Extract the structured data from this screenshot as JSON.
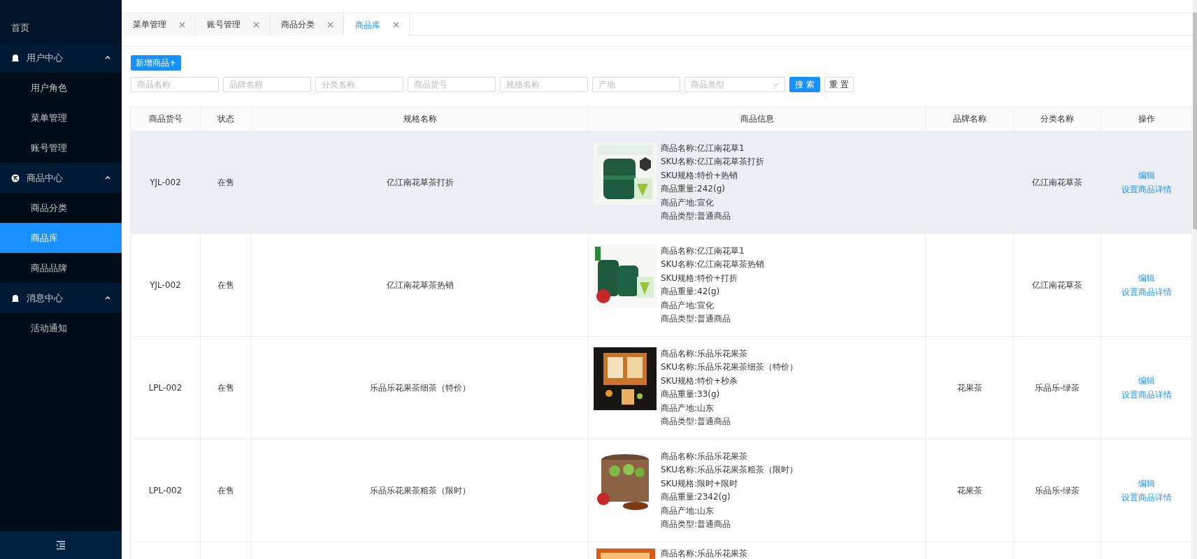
{
  "sidebar": {
    "items": [
      {
        "kind": "link",
        "label": "首页",
        "selected": false
      },
      {
        "kind": "group",
        "label": "用户中心",
        "expanded": true,
        "children": [
          {
            "label": "用户角色",
            "selected": false
          },
          {
            "label": "菜单管理",
            "selected": false
          },
          {
            "label": "账号管理",
            "selected": false
          }
        ]
      },
      {
        "kind": "group",
        "label": "商品中心",
        "expanded": true,
        "children": [
          {
            "label": "商品分类",
            "selected": false
          },
          {
            "label": "商品库",
            "selected": true
          },
          {
            "label": "商品品牌",
            "selected": false
          }
        ]
      },
      {
        "kind": "group",
        "label": "消息中心",
        "expanded": true,
        "children": [
          {
            "label": "活动通知",
            "selected": false
          }
        ]
      }
    ]
  },
  "tabs": [
    {
      "label": "菜单管理",
      "selected": false
    },
    {
      "label": "账号管理",
      "selected": false
    },
    {
      "label": "商品分类",
      "selected": false
    },
    {
      "label": "商品库",
      "selected": true
    }
  ],
  "add_button": "新增商品+",
  "filters": [
    {
      "kind": "input",
      "placeholder": "商品名称"
    },
    {
      "kind": "input",
      "placeholder": "品牌名称"
    },
    {
      "kind": "input",
      "placeholder": "分类名称"
    },
    {
      "kind": "input",
      "placeholder": "商品货号"
    },
    {
      "kind": "input",
      "placeholder": "规格名称"
    },
    {
      "kind": "input",
      "placeholder": "产地"
    },
    {
      "kind": "select",
      "placeholder": "商品类型"
    }
  ],
  "search_button": "搜 索",
  "reset_button": "重 置",
  "table": {
    "columns": [
      "商品货号",
      "状态",
      "规格名称",
      "商品信息",
      "品牌名称",
      "分类名称",
      "操作"
    ],
    "rows": [
      {
        "highlighted": true,
        "code": "YJL-002",
        "status": "在售",
        "spec": "亿江南花草茶打折",
        "info": [
          "商品名称:亿江南花草1",
          "SKU名称:亿江南花草茶打折",
          "SKU规格:特价+热销",
          "商品重量:242(g)",
          "商品产地:宣化",
          "商品类型:普通商品"
        ],
        "category": "亿江南花草茶",
        "actions": [
          "编辑",
          "设置商品详情"
        ]
      },
      {
        "highlighted": false,
        "code": "YJL-002",
        "status": "在售",
        "spec": "亿江南花草茶热销",
        "info": [
          "商品名称:亿江南花草1",
          "SKU名称:亿江南花草茶热销",
          "SKU规格:特价+打折",
          "商品重量:42(g)",
          "商品产地:宣化",
          "商品类型:普通商品"
        ],
        "category": "亿江南花草茶",
        "actions": [
          "编辑",
          "设置商品详情"
        ]
      },
      {
        "highlighted": false,
        "code": "LPL-002",
        "status": "在售",
        "spec": "乐品乐花果茶细茶（特价）",
        "info": [
          "商品名称:乐品乐花果茶",
          "SKU名称:乐品乐花果茶细茶（特价）",
          "SKU规格:特价+秒杀",
          "商品重量:33(g)",
          "商品产地:山东",
          "商品类型:普通商品"
        ],
        "brand": "花果茶",
        "category": "乐品乐-绿茶",
        "actions": [
          "编辑",
          "设置商品详情"
        ]
      },
      {
        "highlighted": false,
        "code": "LPL-002",
        "status": "在售",
        "spec": "乐品乐花果茶粗茶（限时）",
        "info": [
          "商品名称:乐品乐花果茶",
          "SKU名称:乐品乐花果茶粗茶（限时）",
          "SKU规格:限时+限时",
          "商品重量:2342(g)",
          "商品产地:山东",
          "商品类型:普通商品"
        ],
        "brand": "花果茶",
        "category": "乐品乐-绿茶",
        "actions": [
          "编辑",
          "设置商品详情"
        ]
      },
      {
        "highlighted": false,
        "info": [
          "商品名称:乐品乐花果茶"
        ]
      }
    ]
  }
}
